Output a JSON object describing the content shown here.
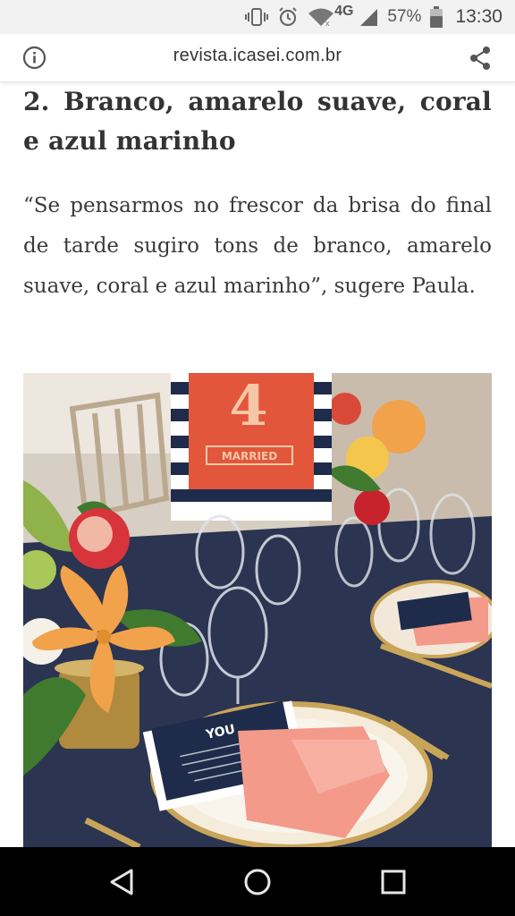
{
  "status_bar": {
    "network": "4G",
    "battery": "57%",
    "time": "13:30",
    "icons": [
      "vibrate-icon",
      "alarm-icon",
      "wifi-icon",
      "signal-icon",
      "battery-icon"
    ]
  },
  "browser": {
    "url": "revista.icasei.com.br",
    "icons": [
      "info-icon",
      "share-icon"
    ]
  },
  "article": {
    "heading": "2. Branco, amarelo suave, coral e azul marinho",
    "quote": "“Se pensarmos no frescor da brisa do final de tarde sugiro tons de branco, amarelo suave, coral e azul marinho”, sugere Paula."
  },
  "photo": {
    "table_number": "4",
    "sign_text": "MARRIED",
    "card_text": "YOU",
    "colors": {
      "tablecloth": "#2b3450",
      "coral": "#f39a8a",
      "orange_sign": "#e2573b",
      "navy_stripe": "#1f2b4a",
      "gold": "#c9a55a",
      "lily": "#f2a24a",
      "leaf": "#3f7a2e"
    }
  },
  "nav_bar": {
    "icons": [
      "back-icon",
      "home-icon",
      "recents-icon"
    ]
  }
}
